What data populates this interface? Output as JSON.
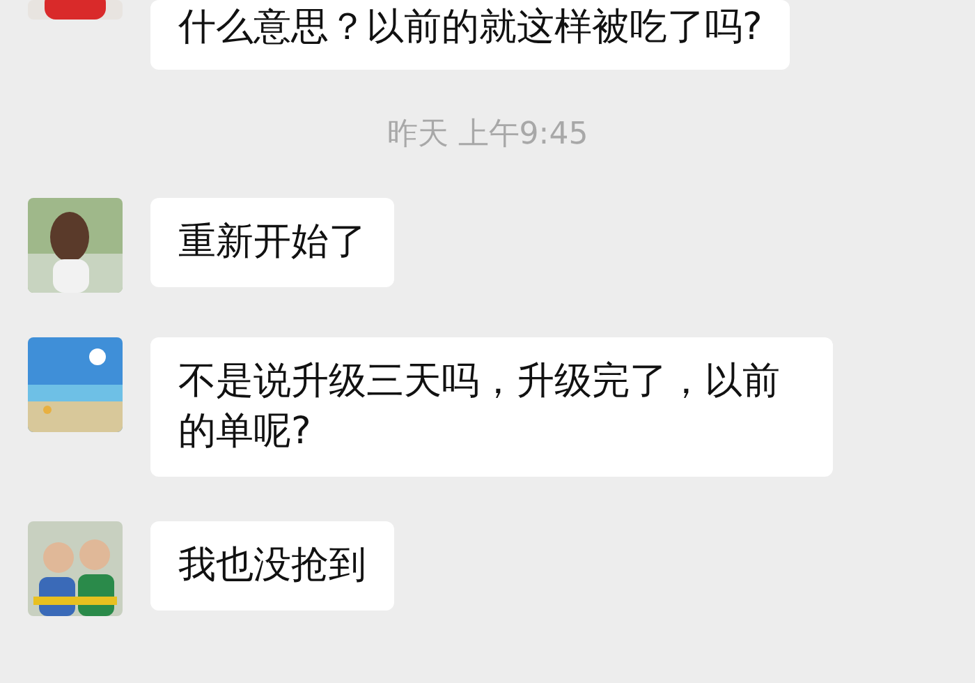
{
  "chat": [
    {
      "kind": "message",
      "text": "什么意思？以前的就这样被吃了吗?"
    },
    {
      "kind": "time",
      "text": "昨天 上午9:45"
    },
    {
      "kind": "message",
      "text": "重新开始了"
    },
    {
      "kind": "message",
      "text": "不是说升级三天吗，升级完了，以前的单呢?"
    },
    {
      "kind": "message",
      "text": "我也没抢到"
    }
  ]
}
